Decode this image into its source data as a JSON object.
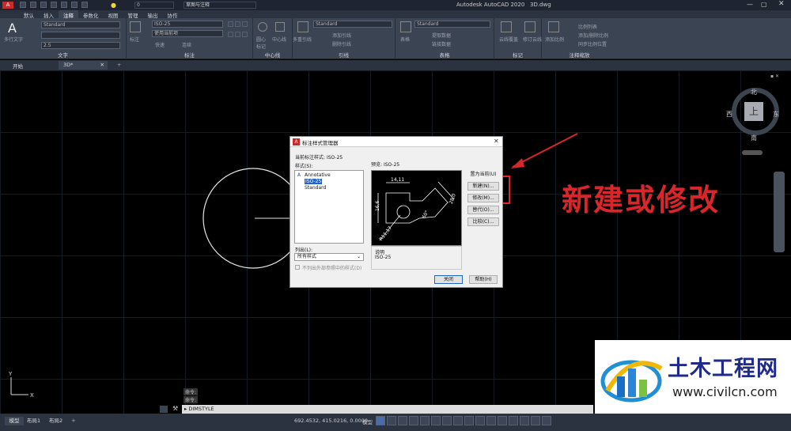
{
  "app": {
    "title": "Autodesk AutoCAD 2020",
    "file": "3D.dwg",
    "workspace": "草图与注释",
    "layer_value": "0"
  },
  "ribbon_tabs": [
    "默认",
    "插入",
    "注释",
    "参数化",
    "视图",
    "管理",
    "输出",
    "协作"
  ],
  "ribbon_active": "注释",
  "ribbon": {
    "text_panel": {
      "title": "文字",
      "big_button": "多行文字",
      "style": "Standard",
      "height": "2.5"
    },
    "dim_panel": {
      "title": "标注",
      "style": "ISO-25",
      "layer": "使用当前项",
      "labels": [
        "标注",
        "快速",
        "连续"
      ]
    },
    "center_panel": {
      "title": "中心线",
      "labels": [
        "圆心",
        "中心线",
        "标记"
      ]
    },
    "leader_panel": {
      "title": "引线",
      "style": "Standard",
      "big_button": "多重引线",
      "labels": [
        "添加引线",
        "删除引线"
      ]
    },
    "table_panel": {
      "title": "表格",
      "style": "Standard",
      "big_button": "表格",
      "labels": [
        "提取数据",
        "链接数据"
      ]
    },
    "markup_panel": {
      "title": "标记",
      "labels": [
        "云线覆盖",
        "修订云线"
      ]
    },
    "scale_panel": {
      "title": "注释缩放",
      "big_button": "添加比例",
      "labels": [
        "比例列表",
        "添加/删除比例",
        "同步比例位置"
      ]
    }
  },
  "file_tabs": {
    "start": "开始",
    "active": "3D*",
    "new_icon": "plus-icon"
  },
  "viewcube": {
    "north": "北",
    "south": "南",
    "east": "东",
    "west": "西",
    "face": "上"
  },
  "dialog": {
    "title": "标注样式管理器",
    "current_style_label": "当前标注样式:",
    "current_style_value": "ISO-25",
    "styles_label": "样式(S):",
    "styles": [
      "Annotative",
      "ISO-25",
      "Standard"
    ],
    "selected_style": "ISO-25",
    "preview_label": "预览:",
    "preview_value": "ISO-25",
    "preview_dims": [
      "14,11",
      "16,6",
      "28,0",
      "60°",
      "R11,17"
    ],
    "list_label": "列出(L):",
    "list_value": "所有样式",
    "checkbox_label": "不列出外部参照中的样式(D)",
    "desc_label": "说明",
    "desc_value": "ISO-25",
    "buttons": {
      "set_current": "置为当前(U)",
      "new": "新建(N)...",
      "modify": "修改(M)...",
      "override": "替代(O)...",
      "compare": "比较(C)...",
      "close": "关闭",
      "help": "帮助(H)"
    }
  },
  "annotation": {
    "text": "新建或修改",
    "color": "#d8262a"
  },
  "command": {
    "history": [
      "命令:",
      "命令:"
    ],
    "input": "DIMSTYLE",
    "prompt_prefix": "▸"
  },
  "layout_tabs": [
    "模型",
    "布局1",
    "布局2"
  ],
  "status": {
    "coords": "692.4532, 415.0216, 0.0000",
    "model": "模型"
  },
  "watermark": {
    "brand": "土木工程网",
    "url": "www.civilcn.com"
  }
}
